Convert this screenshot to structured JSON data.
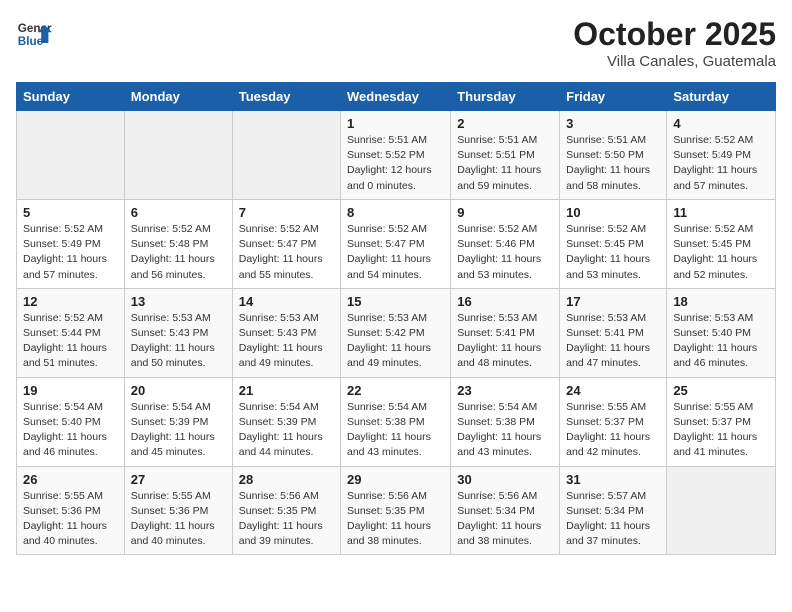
{
  "header": {
    "logo_general": "General",
    "logo_blue": "Blue",
    "month": "October 2025",
    "location": "Villa Canales, Guatemala"
  },
  "weekdays": [
    "Sunday",
    "Monday",
    "Tuesday",
    "Wednesday",
    "Thursday",
    "Friday",
    "Saturday"
  ],
  "weeks": [
    [
      {
        "day": "",
        "sunrise": "",
        "sunset": "",
        "daylight": ""
      },
      {
        "day": "",
        "sunrise": "",
        "sunset": "",
        "daylight": ""
      },
      {
        "day": "",
        "sunrise": "",
        "sunset": "",
        "daylight": ""
      },
      {
        "day": "1",
        "sunrise": "Sunrise: 5:51 AM",
        "sunset": "Sunset: 5:52 PM",
        "daylight": "Daylight: 12 hours and 0 minutes."
      },
      {
        "day": "2",
        "sunrise": "Sunrise: 5:51 AM",
        "sunset": "Sunset: 5:51 PM",
        "daylight": "Daylight: 11 hours and 59 minutes."
      },
      {
        "day": "3",
        "sunrise": "Sunrise: 5:51 AM",
        "sunset": "Sunset: 5:50 PM",
        "daylight": "Daylight: 11 hours and 58 minutes."
      },
      {
        "day": "4",
        "sunrise": "Sunrise: 5:52 AM",
        "sunset": "Sunset: 5:49 PM",
        "daylight": "Daylight: 11 hours and 57 minutes."
      }
    ],
    [
      {
        "day": "5",
        "sunrise": "Sunrise: 5:52 AM",
        "sunset": "Sunset: 5:49 PM",
        "daylight": "Daylight: 11 hours and 57 minutes."
      },
      {
        "day": "6",
        "sunrise": "Sunrise: 5:52 AM",
        "sunset": "Sunset: 5:48 PM",
        "daylight": "Daylight: 11 hours and 56 minutes."
      },
      {
        "day": "7",
        "sunrise": "Sunrise: 5:52 AM",
        "sunset": "Sunset: 5:47 PM",
        "daylight": "Daylight: 11 hours and 55 minutes."
      },
      {
        "day": "8",
        "sunrise": "Sunrise: 5:52 AM",
        "sunset": "Sunset: 5:47 PM",
        "daylight": "Daylight: 11 hours and 54 minutes."
      },
      {
        "day": "9",
        "sunrise": "Sunrise: 5:52 AM",
        "sunset": "Sunset: 5:46 PM",
        "daylight": "Daylight: 11 hours and 53 minutes."
      },
      {
        "day": "10",
        "sunrise": "Sunrise: 5:52 AM",
        "sunset": "Sunset: 5:45 PM",
        "daylight": "Daylight: 11 hours and 53 minutes."
      },
      {
        "day": "11",
        "sunrise": "Sunrise: 5:52 AM",
        "sunset": "Sunset: 5:45 PM",
        "daylight": "Daylight: 11 hours and 52 minutes."
      }
    ],
    [
      {
        "day": "12",
        "sunrise": "Sunrise: 5:52 AM",
        "sunset": "Sunset: 5:44 PM",
        "daylight": "Daylight: 11 hours and 51 minutes."
      },
      {
        "day": "13",
        "sunrise": "Sunrise: 5:53 AM",
        "sunset": "Sunset: 5:43 PM",
        "daylight": "Daylight: 11 hours and 50 minutes."
      },
      {
        "day": "14",
        "sunrise": "Sunrise: 5:53 AM",
        "sunset": "Sunset: 5:43 PM",
        "daylight": "Daylight: 11 hours and 49 minutes."
      },
      {
        "day": "15",
        "sunrise": "Sunrise: 5:53 AM",
        "sunset": "Sunset: 5:42 PM",
        "daylight": "Daylight: 11 hours and 49 minutes."
      },
      {
        "day": "16",
        "sunrise": "Sunrise: 5:53 AM",
        "sunset": "Sunset: 5:41 PM",
        "daylight": "Daylight: 11 hours and 48 minutes."
      },
      {
        "day": "17",
        "sunrise": "Sunrise: 5:53 AM",
        "sunset": "Sunset: 5:41 PM",
        "daylight": "Daylight: 11 hours and 47 minutes."
      },
      {
        "day": "18",
        "sunrise": "Sunrise: 5:53 AM",
        "sunset": "Sunset: 5:40 PM",
        "daylight": "Daylight: 11 hours and 46 minutes."
      }
    ],
    [
      {
        "day": "19",
        "sunrise": "Sunrise: 5:54 AM",
        "sunset": "Sunset: 5:40 PM",
        "daylight": "Daylight: 11 hours and 46 minutes."
      },
      {
        "day": "20",
        "sunrise": "Sunrise: 5:54 AM",
        "sunset": "Sunset: 5:39 PM",
        "daylight": "Daylight: 11 hours and 45 minutes."
      },
      {
        "day": "21",
        "sunrise": "Sunrise: 5:54 AM",
        "sunset": "Sunset: 5:39 PM",
        "daylight": "Daylight: 11 hours and 44 minutes."
      },
      {
        "day": "22",
        "sunrise": "Sunrise: 5:54 AM",
        "sunset": "Sunset: 5:38 PM",
        "daylight": "Daylight: 11 hours and 43 minutes."
      },
      {
        "day": "23",
        "sunrise": "Sunrise: 5:54 AM",
        "sunset": "Sunset: 5:38 PM",
        "daylight": "Daylight: 11 hours and 43 minutes."
      },
      {
        "day": "24",
        "sunrise": "Sunrise: 5:55 AM",
        "sunset": "Sunset: 5:37 PM",
        "daylight": "Daylight: 11 hours and 42 minutes."
      },
      {
        "day": "25",
        "sunrise": "Sunrise: 5:55 AM",
        "sunset": "Sunset: 5:37 PM",
        "daylight": "Daylight: 11 hours and 41 minutes."
      }
    ],
    [
      {
        "day": "26",
        "sunrise": "Sunrise: 5:55 AM",
        "sunset": "Sunset: 5:36 PM",
        "daylight": "Daylight: 11 hours and 40 minutes."
      },
      {
        "day": "27",
        "sunrise": "Sunrise: 5:55 AM",
        "sunset": "Sunset: 5:36 PM",
        "daylight": "Daylight: 11 hours and 40 minutes."
      },
      {
        "day": "28",
        "sunrise": "Sunrise: 5:56 AM",
        "sunset": "Sunset: 5:35 PM",
        "daylight": "Daylight: 11 hours and 39 minutes."
      },
      {
        "day": "29",
        "sunrise": "Sunrise: 5:56 AM",
        "sunset": "Sunset: 5:35 PM",
        "daylight": "Daylight: 11 hours and 38 minutes."
      },
      {
        "day": "30",
        "sunrise": "Sunrise: 5:56 AM",
        "sunset": "Sunset: 5:34 PM",
        "daylight": "Daylight: 11 hours and 38 minutes."
      },
      {
        "day": "31",
        "sunrise": "Sunrise: 5:57 AM",
        "sunset": "Sunset: 5:34 PM",
        "daylight": "Daylight: 11 hours and 37 minutes."
      },
      {
        "day": "",
        "sunrise": "",
        "sunset": "",
        "daylight": ""
      }
    ]
  ]
}
